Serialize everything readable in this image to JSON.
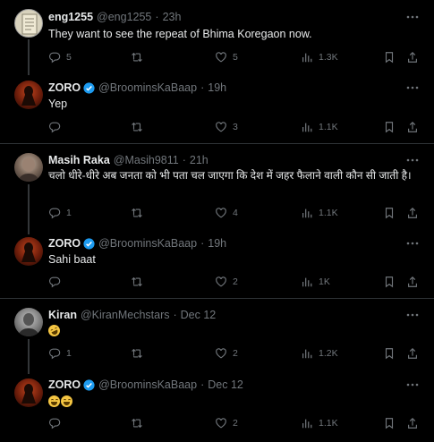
{
  "tweets": [
    {
      "name": "eng1255",
      "handle": "@eng1255",
      "time": "23h",
      "text": "They want to see the repeat of Bhima Koregaon now.",
      "replies": "5",
      "likes": "5",
      "views": "1.3K",
      "verified": false
    },
    {
      "name": "ZORO",
      "handle": "@BroominsKaBaap",
      "time": "19h",
      "text": "Yep",
      "replies": "",
      "likes": "3",
      "views": "1.1K",
      "verified": true
    },
    {
      "name": "Masih Raka",
      "handle": "@Masih9811",
      "time": "21h",
      "text": "चलो धीरे-धीरे अब जनता को भी पता चल जाएगा कि देश में जहर फैलाने वाली कौन सी जाती है।",
      "replies": "1",
      "likes": "4",
      "views": "1.1K",
      "verified": false
    },
    {
      "name": "ZORO",
      "handle": "@BroominsKaBaap",
      "time": "19h",
      "text": "Sahi baat",
      "replies": "",
      "likes": "2",
      "views": "1K",
      "verified": true
    },
    {
      "name": "Kiran",
      "handle": "@KiranMechstars",
      "time": "Dec 12",
      "text": "",
      "emoji": "rofl-emoji",
      "replies": "1",
      "likes": "2",
      "views": "1.2K",
      "verified": false
    },
    {
      "name": "ZORO",
      "handle": "@BroominsKaBaap",
      "time": "Dec 12",
      "text": "",
      "emoji": "joy-emoji-x2",
      "replies": "",
      "likes": "2",
      "views": "1.1K",
      "verified": true
    }
  ],
  "colors": {
    "background": "#000000",
    "text": "#e7e9ea",
    "muted": "#71767b",
    "verified": "#1d9bf0",
    "divider": "#2f3336"
  }
}
